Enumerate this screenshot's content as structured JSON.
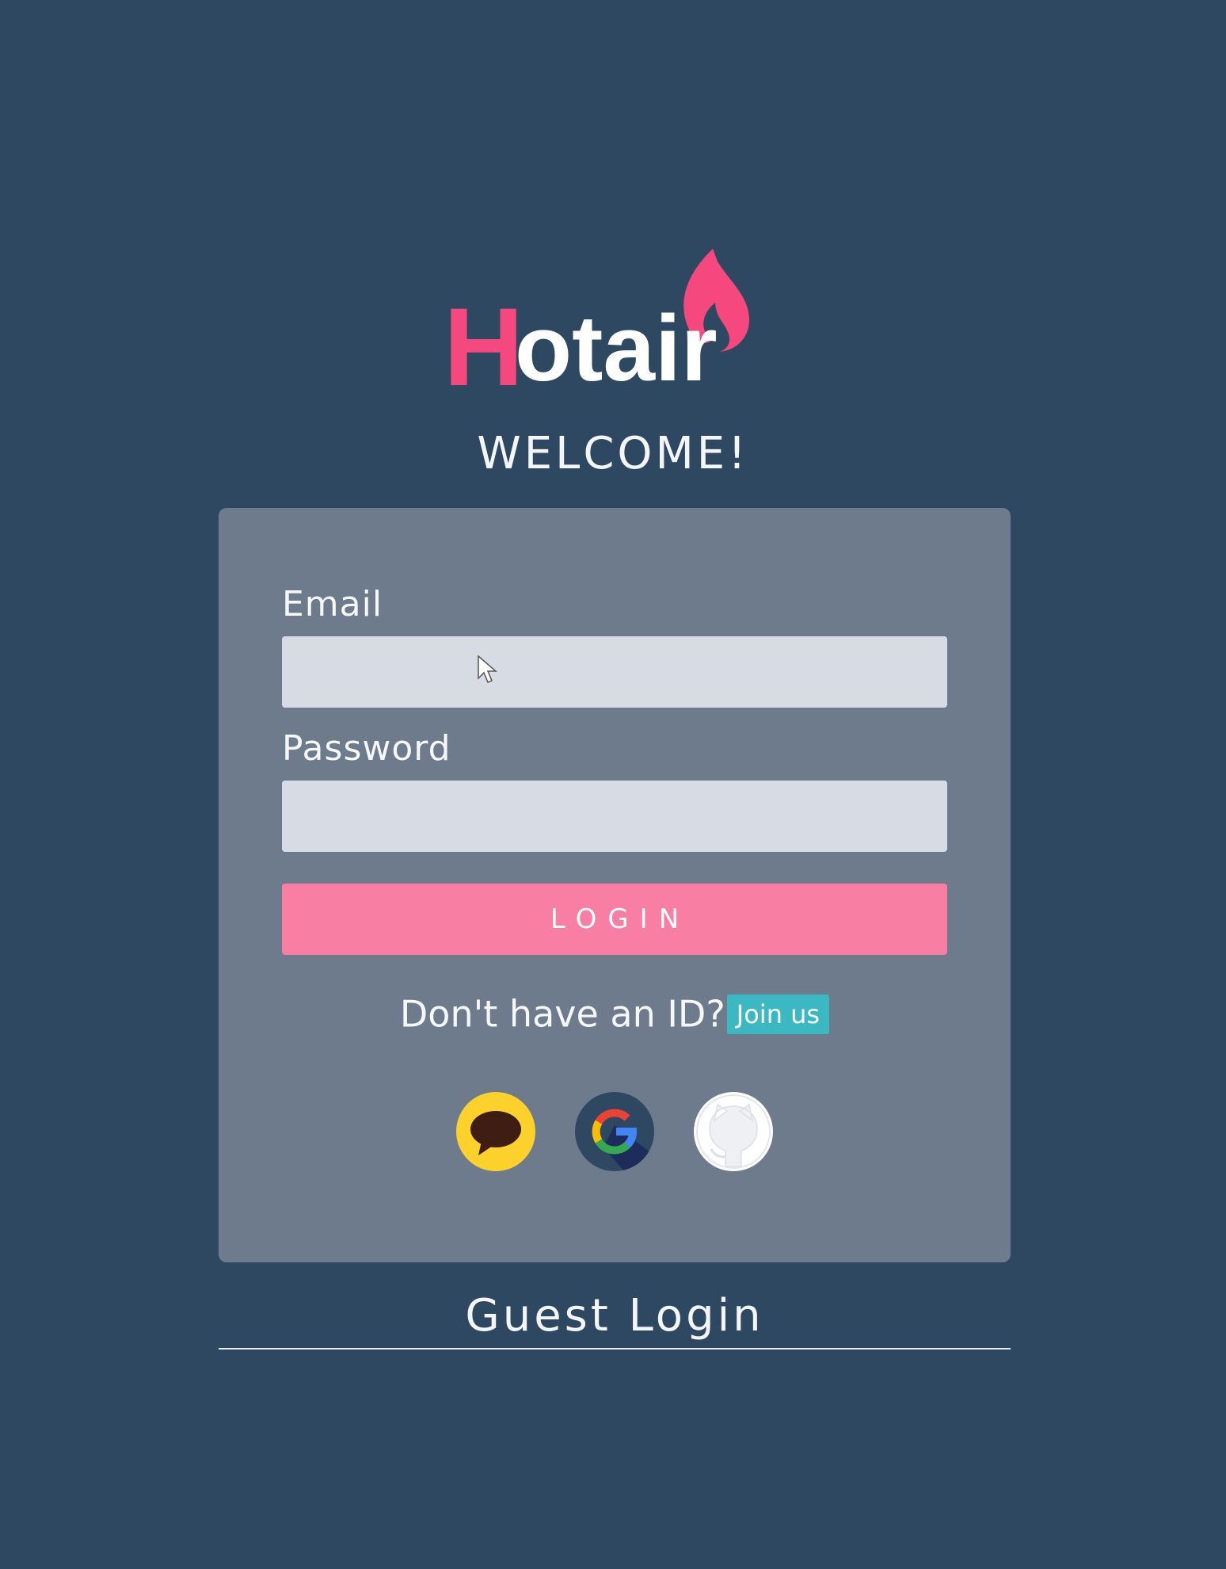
{
  "brand": {
    "name": "Hotair",
    "initial": "H",
    "rest": "otair",
    "initial_color": "#f4487e",
    "flame_color": "#f4487e",
    "rest_color": "#ffffff"
  },
  "welcome": "WELCOME!",
  "form": {
    "email_label": "Email",
    "email_value": "",
    "password_label": "Password",
    "password_value": "",
    "login_label": "LOGIN"
  },
  "signup": {
    "prompt": "Don't have an ID?",
    "join_label": "Join us"
  },
  "social": [
    {
      "name": "kakao",
      "icon": "kakao-icon"
    },
    {
      "name": "google",
      "icon": "google-icon"
    },
    {
      "name": "github",
      "icon": "github-icon"
    }
  ],
  "guest_login": "Guest Login",
  "colors": {
    "background": "#2e4862",
    "card": "#6e7b8d",
    "input": "#d7dce4",
    "login_button": "#f87ea3",
    "join_button": "#3bb8c2"
  }
}
